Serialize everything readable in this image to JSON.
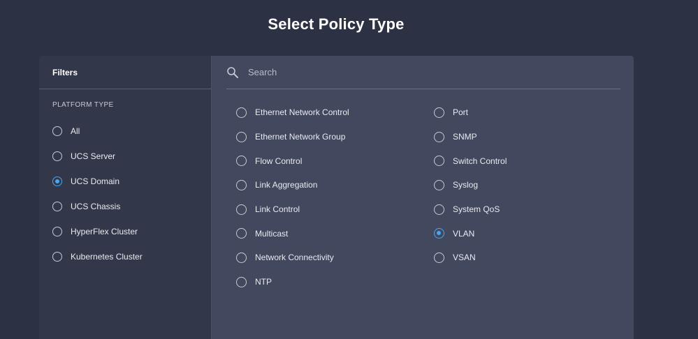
{
  "page": {
    "title": "Select Policy Type"
  },
  "filters": {
    "header": "Filters",
    "section_label": "PLATFORM TYPE",
    "items": [
      {
        "label": "All",
        "checked": false
      },
      {
        "label": "UCS Server",
        "checked": false
      },
      {
        "label": "UCS Domain",
        "checked": true
      },
      {
        "label": "UCS Chassis",
        "checked": false
      },
      {
        "label": "HyperFlex Cluster",
        "checked": false
      },
      {
        "label": "Kubernetes Cluster",
        "checked": false
      }
    ]
  },
  "search": {
    "placeholder": "Search",
    "value": ""
  },
  "policies": {
    "left": [
      {
        "label": "Ethernet Network Control",
        "checked": false
      },
      {
        "label": "Ethernet Network Group",
        "checked": false
      },
      {
        "label": "Flow Control",
        "checked": false
      },
      {
        "label": "Link Aggregation",
        "checked": false
      },
      {
        "label": "Link Control",
        "checked": false
      },
      {
        "label": "Multicast",
        "checked": false
      },
      {
        "label": "Network Connectivity",
        "checked": false
      },
      {
        "label": "NTP",
        "checked": false
      }
    ],
    "right": [
      {
        "label": "Port",
        "checked": false
      },
      {
        "label": "SNMP",
        "checked": false
      },
      {
        "label": "Switch Control",
        "checked": false
      },
      {
        "label": "Syslog",
        "checked": false
      },
      {
        "label": "System QoS",
        "checked": false
      },
      {
        "label": "VLAN",
        "checked": true
      },
      {
        "label": "VSAN",
        "checked": false
      }
    ]
  },
  "colors": {
    "accent": "#49a6f0",
    "background": "#2c3143",
    "panel": "#42485d",
    "sidebar": "#323849"
  },
  "icons": {
    "search": "search-icon"
  }
}
